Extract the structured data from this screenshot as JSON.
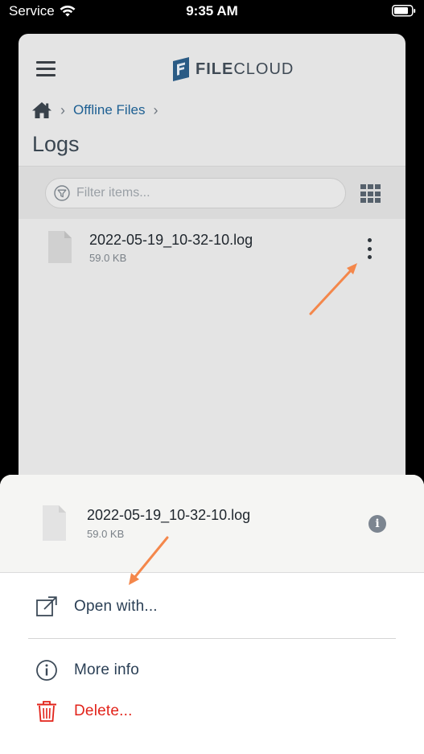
{
  "status_bar": {
    "carrier": "Service",
    "time": "9:35 AM"
  },
  "app": {
    "logo_text_bold": "FILE",
    "logo_text_rest": "CLOUD",
    "breadcrumb": [
      "Offline Files"
    ],
    "page_title": "Logs",
    "filter_placeholder": "Filter items...",
    "files": [
      {
        "name": "2022-05-19_10-32-10.log",
        "size": "59.0 KB"
      }
    ]
  },
  "sheet": {
    "file_name": "2022-05-19_10-32-10.log",
    "file_size": "59.0 KB",
    "actions": [
      {
        "label": "Open with...",
        "icon": "open-external-icon"
      },
      {
        "label": "More info",
        "icon": "info-icon"
      },
      {
        "label": "Delete...",
        "icon": "trash-icon"
      }
    ]
  },
  "colors": {
    "accent_link": "#1d5f92",
    "danger": "#e2231a",
    "annotation_arrow": "#f4874b"
  }
}
